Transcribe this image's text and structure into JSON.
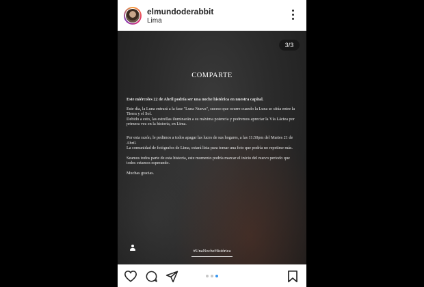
{
  "post": {
    "username": "elmundoderabbit",
    "location": "Lima",
    "counter": "3/3",
    "carousel": {
      "total": 3,
      "active_index": 3
    },
    "image_text": {
      "title": "COMPARTE",
      "lead": "Este miércoles 22 de Abril podría ser una noche histórica en nuestra capital.",
      "p1": "Este día, la Luna entrará a la fase \"Luna Nueva\", suceso que ocurre cuando la Luna se sitúa entre la Tierra y el Sol.",
      "p2": "Debido a esto, las estrellas iluminarán a su máxima potencia y podremos apreciar la Vía Láctea por primera vez en la historia, en Lima.",
      "p3": "Por esta razón, le pedimos a todos apagar las luces de sus hogares, a las 11:50pm del Martes 21 de Abril.",
      "p4": "La comunidad de fotógrafos de Lima, estará lista para tomar una foto que podría no repetirse más.",
      "p5": "Seamos todos parte de esta historia, este momento podría marcar el inicio del nuevo periodo que todos estamos esperando.",
      "p6": "Muchas gracias.",
      "hashtag": "#UnaNocheHistórica"
    }
  },
  "icons": {
    "more": "more-options-icon",
    "user_tag": "user-tag-icon",
    "like": "heart-icon",
    "comment": "comment-icon",
    "share": "share-icon",
    "save": "bookmark-icon"
  },
  "colors": {
    "active_dot": "#3897f0",
    "inactive_dot": "#c7c7c7",
    "text": "#262626"
  }
}
